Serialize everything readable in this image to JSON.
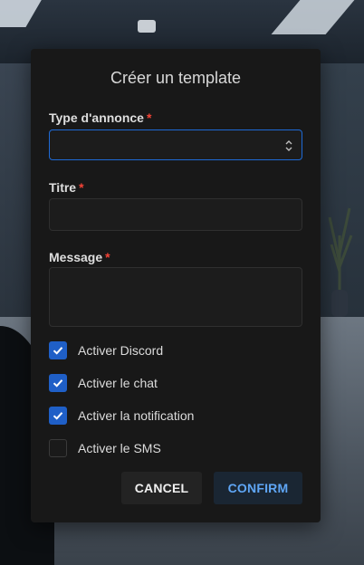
{
  "modal": {
    "title": "Créer un template",
    "fields": {
      "type": {
        "label": "Type d'annonce",
        "required_mark": "*",
        "value": ""
      },
      "titre": {
        "label": "Titre",
        "required_mark": "*",
        "value": ""
      },
      "message": {
        "label": "Message",
        "required_mark": "*",
        "value": ""
      }
    },
    "checkboxes": [
      {
        "label": "Activer Discord",
        "checked": true
      },
      {
        "label": "Activer le chat",
        "checked": true
      },
      {
        "label": "Activer la notification",
        "checked": true
      },
      {
        "label": "Activer le SMS",
        "checked": false
      }
    ],
    "buttons": {
      "cancel": "CANCEL",
      "confirm": "CONFIRM"
    }
  },
  "colors": {
    "accent": "#1f5fc7",
    "confirm_text": "#5fa6f5",
    "required": "#f44336",
    "modal_bg": "#181818"
  },
  "icons": {
    "checkmark": "check-icon",
    "select_arrows": "select-arrows-icon"
  }
}
